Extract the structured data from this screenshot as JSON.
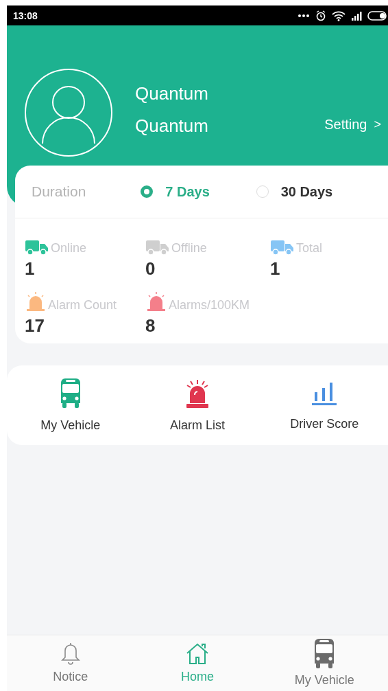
{
  "status_bar": {
    "time": "13:08"
  },
  "profile": {
    "name_line_1": "Quantum",
    "name_line_2": "Quantum",
    "setting": "Setting",
    "setting_arrow": ">"
  },
  "duration": {
    "label": "Duration",
    "options": [
      {
        "label": "7 Days",
        "selected": true
      },
      {
        "label": "30 Days",
        "selected": false
      }
    ]
  },
  "stats": [
    {
      "kind": "truck",
      "color": "#2ec39a",
      "label": "Online",
      "value": "1"
    },
    {
      "kind": "truck",
      "color": "#cfcfcf",
      "label": "Offline",
      "value": "0"
    },
    {
      "kind": "truck",
      "color": "#86c5f5",
      "label": "Total",
      "value": "1"
    },
    {
      "kind": "alarm",
      "color": "#fbb880",
      "label": "Alarm Count",
      "value": "17"
    },
    {
      "kind": "alarm",
      "color": "#f47f8a",
      "label": "Alarms/100KM",
      "value": "8"
    }
  ],
  "shortcuts": [
    {
      "kind": "bus",
      "label": "My Vehicle"
    },
    {
      "kind": "siren",
      "label": "Alarm List"
    },
    {
      "kind": "chart",
      "label": "Driver Score"
    }
  ],
  "bottom_nav": [
    {
      "kind": "bell",
      "label": "Notice",
      "selected": false
    },
    {
      "kind": "home",
      "label": "Home",
      "selected": true
    },
    {
      "kind": "bus",
      "label": "My Vehicle",
      "selected": false
    }
  ]
}
